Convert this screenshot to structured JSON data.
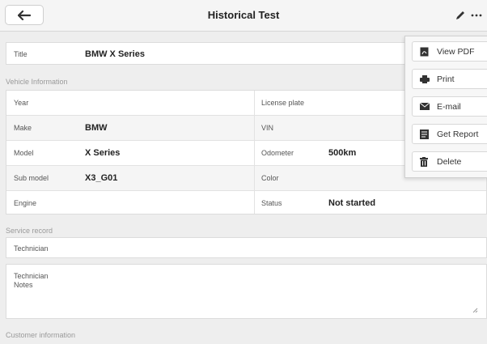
{
  "header": {
    "title": "Historical Test",
    "back_icon": "arrow-left-icon",
    "edit_icon": "pencil-icon",
    "more_icon": "more-horizontal-icon"
  },
  "title_field": {
    "label": "Title",
    "value": "BMW X Series"
  },
  "vehicle_info": {
    "section_label": "Vehicle Information",
    "rows": [
      {
        "left_label": "Year",
        "left_value": "",
        "right_label": "License plate",
        "right_value": ""
      },
      {
        "left_label": "Make",
        "left_value": "BMW",
        "right_label": "VIN",
        "right_value": ""
      },
      {
        "left_label": "Model",
        "left_value": "X Series",
        "right_label": "Odometer",
        "right_value": "500km"
      },
      {
        "left_label": "Sub model",
        "left_value": "X3_G01",
        "right_label": "Color",
        "right_value": ""
      },
      {
        "left_label": "Engine",
        "left_value": "",
        "right_label": "Status",
        "right_value": "Not started"
      }
    ]
  },
  "service_record": {
    "section_label": "Service record",
    "technician_placeholder": "Technician",
    "notes_placeholder": "Technician\nNotes"
  },
  "customer_info": {
    "section_label": "Customer information"
  },
  "menu": {
    "items": [
      {
        "label": "View PDF",
        "icon": "pdf-icon"
      },
      {
        "label": "Print",
        "icon": "printer-icon"
      },
      {
        "label": "E-mail",
        "icon": "mail-icon"
      },
      {
        "label": "Get Report",
        "icon": "report-icon"
      },
      {
        "label": "Delete",
        "icon": "trash-icon"
      }
    ]
  },
  "colors": {
    "background": "#eeeeee",
    "card": "#ffffff",
    "alt_row": "#f5f5f5",
    "muted_text": "#9a9a9a"
  }
}
